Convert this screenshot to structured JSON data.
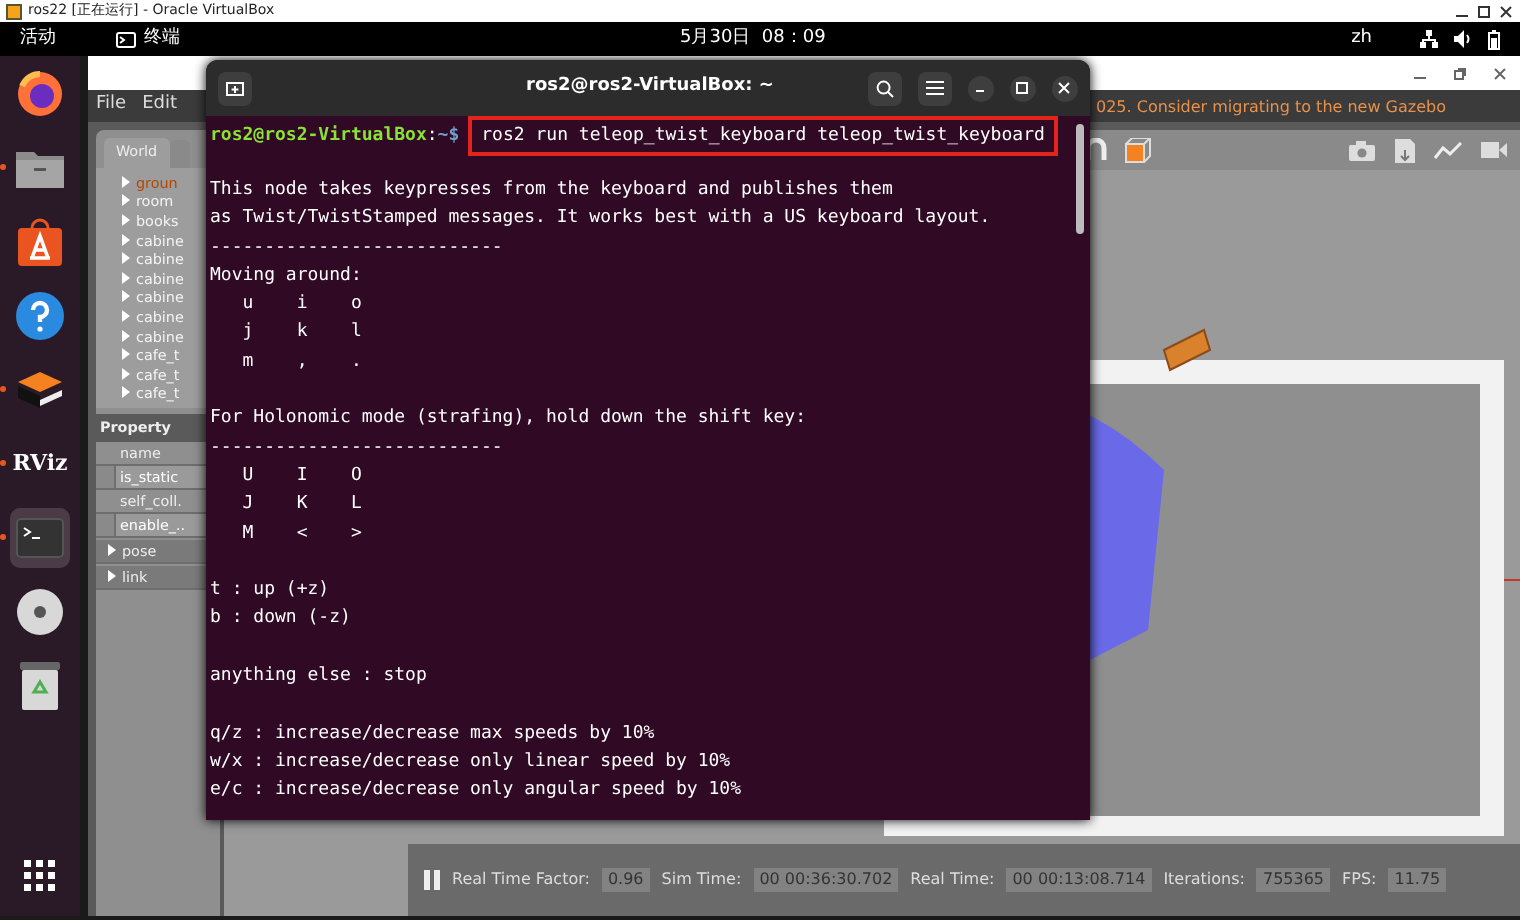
{
  "host_window": {
    "title": "ros22 [正在运行] - Oracle VirtualBox"
  },
  "top_bar": {
    "activities": "活动",
    "app": "终端",
    "clock": "5月30日  08：09",
    "input_method": "zh"
  },
  "dock": {
    "items": [
      {
        "kind": "browser",
        "running": false,
        "selected": false
      },
      {
        "kind": "files",
        "running": true,
        "selected": false
      },
      {
        "kind": "store",
        "running": false,
        "selected": false
      },
      {
        "kind": "help",
        "running": false,
        "selected": false
      },
      {
        "kind": "gazebo",
        "running": true,
        "selected": false
      },
      {
        "kind": "rviz",
        "label": "RViz",
        "running": true,
        "selected": false
      },
      {
        "kind": "terminal",
        "running": true,
        "selected": true
      },
      {
        "kind": "disc",
        "running": false,
        "selected": false
      },
      {
        "kind": "trash",
        "running": false,
        "selected": false
      }
    ]
  },
  "gazebo": {
    "menu": [
      "File",
      "Edit"
    ],
    "notice": {
      "text": "025. Consider",
      "link": "migrating to the new Gazebo"
    },
    "tabs": [
      {
        "label": "World",
        "selected": true
      }
    ],
    "tree": [
      {
        "label": "groun",
        "selected": true
      },
      {
        "label": "room",
        "selected": false
      },
      {
        "label": "books",
        "selected": false
      },
      {
        "label": "cabine",
        "selected": false
      },
      {
        "label": "cabine",
        "selected": false
      },
      {
        "label": "cabine",
        "selected": false
      },
      {
        "label": "cabine",
        "selected": false
      },
      {
        "label": "cabine",
        "selected": false
      },
      {
        "label": "cabine",
        "selected": false
      },
      {
        "label": "cafe_t",
        "selected": false
      },
      {
        "label": "cafe_t",
        "selected": false
      },
      {
        "label": "cafe_t",
        "selected": false
      }
    ],
    "property": {
      "header": "Property",
      "rows": [
        {
          "kind": "field",
          "label": "name"
        },
        {
          "kind": "check",
          "label": "is_static"
        },
        {
          "kind": "field",
          "label": "self_coll."
        },
        {
          "kind": "check",
          "label": "enable_.."
        },
        {
          "kind": "group",
          "label": "pose"
        },
        {
          "kind": "group",
          "label": "link"
        }
      ]
    },
    "status": [
      {
        "label": "Real Time Factor:",
        "value": "0.96"
      },
      {
        "label": "Sim Time:",
        "value": "00 00:36:30.702"
      },
      {
        "label": "Real Time:",
        "value": "00 00:13:08.714"
      },
      {
        "label": "Iterations:",
        "value": "755365"
      },
      {
        "label": "FPS:",
        "value": "11.75"
      }
    ]
  },
  "terminal": {
    "title": "ros2@ros2-VirtualBox: ~",
    "prompt": {
      "user": "ros2@ros2-VirtualBox",
      "separator": ":",
      "path": "~$",
      "command": "ros2 run teleop_twist_keyboard teleop_twist_keyboard",
      "highlighted": true
    },
    "paragraphs": [
      [
        "This node takes keypresses from the keyboard and publishes them",
        "as Twist/TwistStamped messages. It works best with a US keyboard layout.",
        "---------------------------",
        "Moving around:",
        "   u    i    o",
        "   j    k    l",
        "   m    ,    ."
      ],
      [
        "For Holonomic mode (strafing), hold down the shift key:",
        "---------------------------",
        "   U    I    O",
        "   J    K    L",
        "   M    <    >"
      ],
      [
        "t : up (+z)",
        "b : down (-z)"
      ],
      [
        "anything else : stop"
      ],
      [
        "q/z : increase/decrease max speeds by 10%",
        "w/x : increase/decrease only linear speed by 10%",
        "e/c : increase/decrease only angular speed by 10%"
      ]
    ]
  }
}
